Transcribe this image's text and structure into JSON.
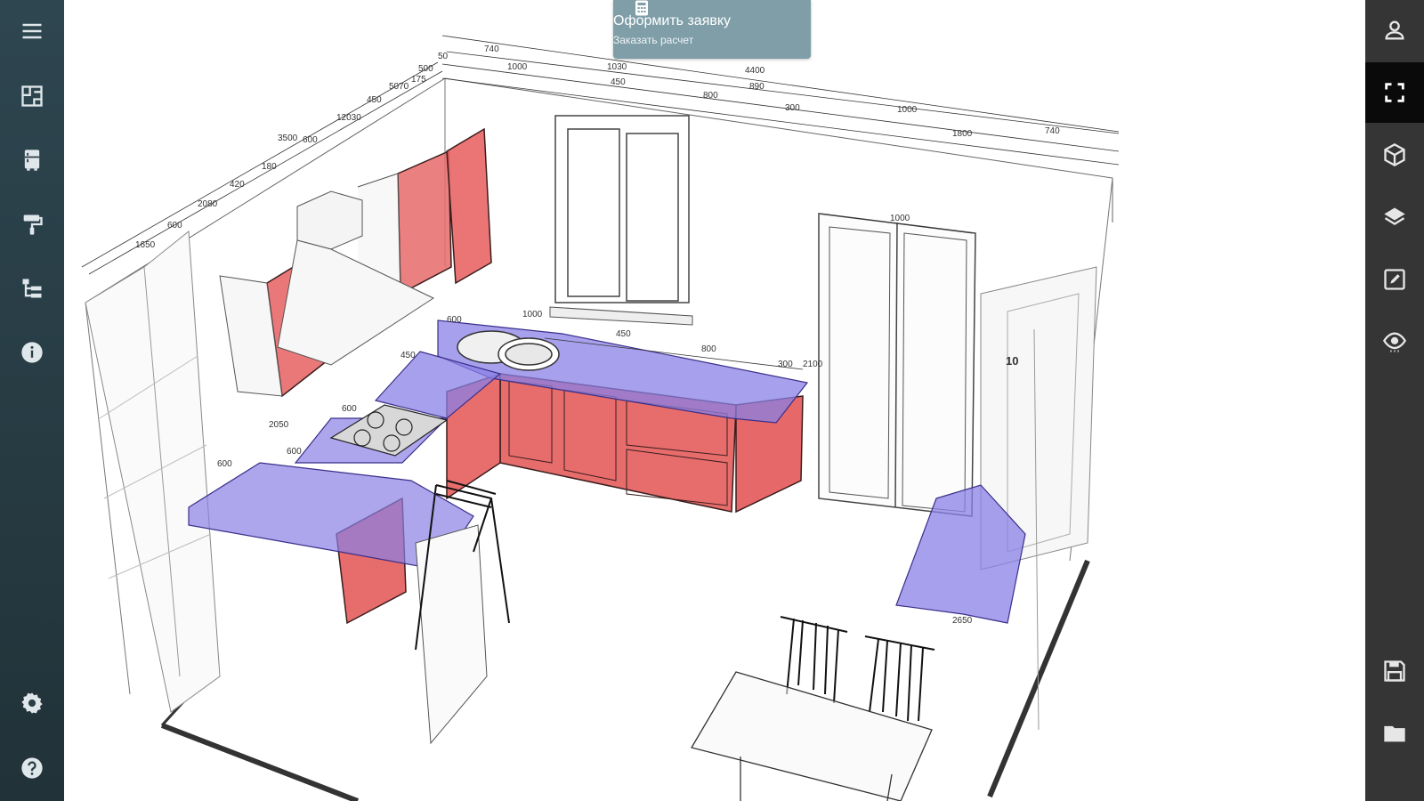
{
  "order_button": {
    "title": "Оформить заявку",
    "subtitle": "Заказать расчет",
    "background": "#7f9ea8"
  },
  "left_toolbar": {
    "items": [
      {
        "icon": "menu-icon"
      },
      {
        "icon": "floor-plan-icon"
      },
      {
        "icon": "furniture-icon"
      },
      {
        "icon": "paint-roller-icon"
      },
      {
        "icon": "hierarchy-icon"
      },
      {
        "icon": "info-icon"
      },
      {
        "icon": "settings-gear-icon"
      },
      {
        "icon": "help-icon"
      }
    ]
  },
  "right_toolbar": {
    "items": [
      {
        "icon": "user-icon"
      },
      {
        "icon": "fullscreen-icon",
        "active": true
      },
      {
        "icon": "cube-3d-icon"
      },
      {
        "icon": "layers-icon"
      },
      {
        "icon": "edit-icon"
      },
      {
        "icon": "eye-icon"
      },
      {
        "icon": "save-icon"
      },
      {
        "icon": "folder-icon"
      }
    ]
  },
  "colors": {
    "cabinet_fill": "#e85a5a",
    "countertop_fill": "#8f86e6",
    "line": "#333333",
    "sidebar": "#2a3e46",
    "right_bar": "#353535"
  },
  "dimensions": {
    "top": [
      "740",
      "1000",
      "1030",
      "450",
      "800",
      "890",
      "300",
      "4400",
      "1000",
      "1800",
      "740"
    ],
    "left": [
      "1650",
      "600",
      "2080",
      "420",
      "180",
      "3500",
      "600",
      "12030",
      "450",
      "5070",
      "175",
      "500",
      "50"
    ],
    "window": [
      "1000",
      "450",
      "800",
      "300",
      "2100"
    ],
    "door": [
      "1000"
    ],
    "cabinet_height": [
      "2050",
      "2650"
    ],
    "side": [
      "600",
      "600",
      "600",
      "450",
      "600"
    ],
    "right_wall": [
      "10"
    ]
  }
}
